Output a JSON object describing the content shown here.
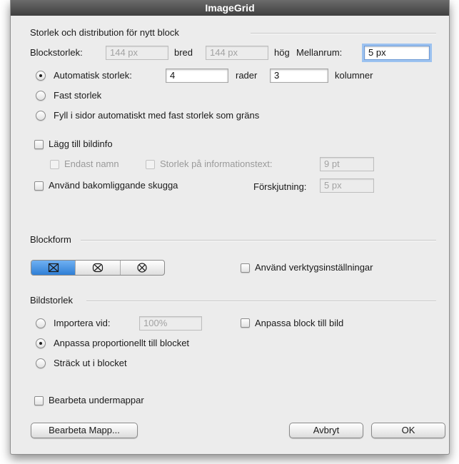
{
  "window": {
    "title": "ImageGrid"
  },
  "size_section": {
    "title": "Storlek och distribution för nytt block",
    "block_size_label": "Blockstorlek:",
    "width_value": "144 px",
    "width_unit": "bred",
    "height_value": "144 px",
    "height_unit": "hög",
    "spacing_label": "Mellanrum:",
    "spacing_value": "5 px",
    "auto_size_label": "Automatisk storlek:",
    "rows_value": "4",
    "rows_label": "rader",
    "cols_value": "3",
    "cols_label": "kolumner",
    "fixed_size_label": "Fast storlek",
    "fill_pages_label": "Fyll i sidor automatiskt med fast storlek som gräns",
    "selected_option": "auto"
  },
  "info": {
    "add_info_label": "Lägg till bildinfo",
    "name_only_label": "Endast namn",
    "info_text_size_label": "Storlek på informationstext:",
    "info_text_size_value": "9 pt",
    "shadow_label": "Använd bakomliggande skugga",
    "offset_label": "Förskjutning:",
    "offset_value": "5 px"
  },
  "block_shape": {
    "title": "Blockform",
    "options": [
      "rectangle-cross-icon",
      "rounded-cross-icon",
      "circle-cross-icon"
    ],
    "selected_index": 0,
    "use_tool_settings_label": "Använd verktygsinställningar"
  },
  "image_size": {
    "title": "Bildstorlek",
    "import_at_label": "Importera vid:",
    "import_at_value": "100%",
    "fit_block_label": "Anpassa block till bild",
    "fit_proportional_label": "Anpassa proportionellt till blocket",
    "stretch_label": "Sträck ut i blocket",
    "selected_option": "fit_proportional"
  },
  "process_subfolders_label": "Bearbeta undermappar",
  "buttons": {
    "process_folder": "Bearbeta Mapp...",
    "cancel": "Avbryt",
    "ok": "OK"
  },
  "colors": {
    "title_bar": "#4a4a4a",
    "selection_blue": "#2f7fd6",
    "focus_ring": "#9cc2f0"
  }
}
